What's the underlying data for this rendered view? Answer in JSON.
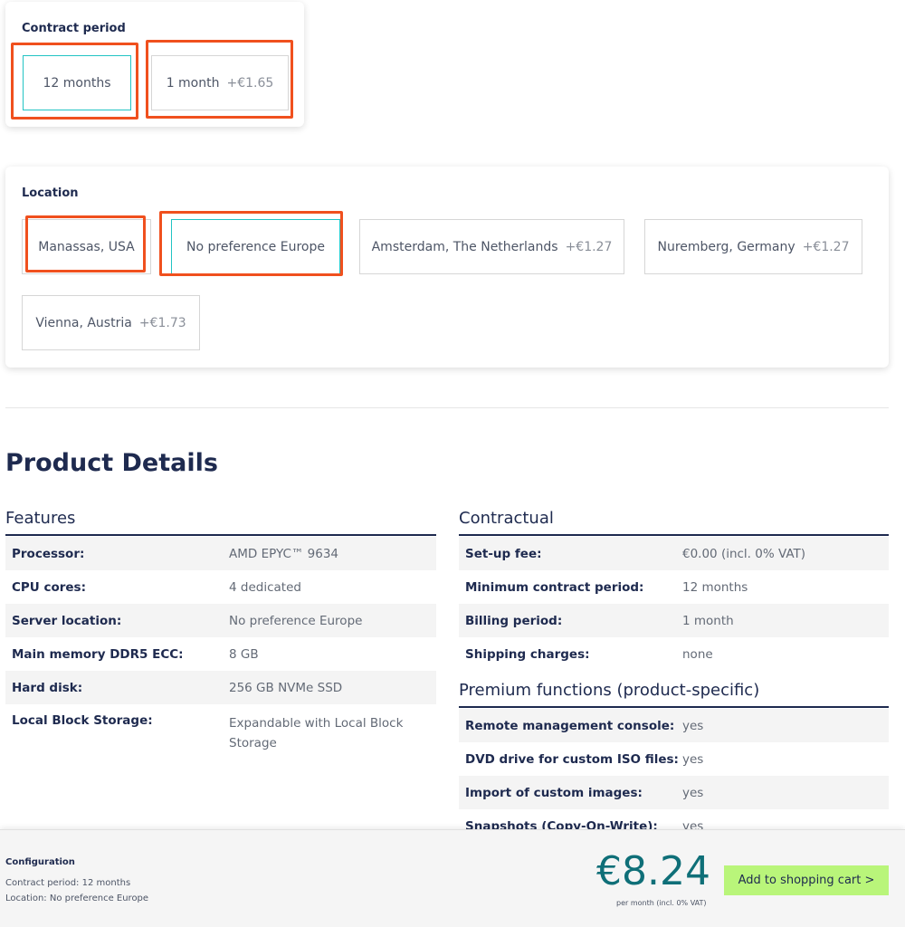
{
  "contract_period": {
    "title": "Contract period",
    "options": [
      {
        "label": "12 months",
        "price": ""
      },
      {
        "label": "1 month",
        "price": "+€1.65"
      }
    ]
  },
  "location": {
    "title": "Location",
    "options": [
      {
        "label": "Manassas, USA",
        "price": ""
      },
      {
        "label": "No preference Europe",
        "price": ""
      },
      {
        "label": "Amsterdam, The Netherlands",
        "price": "+€1.27"
      },
      {
        "label": "Nuremberg, Germany",
        "price": "+€1.27"
      },
      {
        "label": "Vienna, Austria",
        "price": "+€1.73"
      }
    ]
  },
  "product_details": {
    "title": "Product Details",
    "features": {
      "title": "Features",
      "rows": [
        {
          "label": "Processor:",
          "value": "AMD EPYC™ 9634"
        },
        {
          "label": "CPU cores:",
          "value": "4 dedicated"
        },
        {
          "label": "Server location:",
          "value": "No preference Europe"
        },
        {
          "label": "Main memory DDR5 ECC:",
          "value": "8 GB"
        },
        {
          "label": "Hard disk:",
          "value": "256 GB NVMe SSD"
        },
        {
          "label": "Local Block Storage:",
          "value": "Expandable with Local Block Storage"
        }
      ]
    },
    "contractual": {
      "title": "Contractual",
      "rows": [
        {
          "label": "Set-up fee:",
          "value": "€0.00 (incl. 0% VAT)"
        },
        {
          "label": "Minimum contract period:",
          "value": "12 months"
        },
        {
          "label": "Billing period:",
          "value": "1 month"
        },
        {
          "label": "Shipping charges:",
          "value": "none"
        }
      ]
    },
    "premium": {
      "title": "Premium functions (product-specific)",
      "rows": [
        {
          "label": "Remote management console:",
          "value": "yes"
        },
        {
          "label": "DVD drive for custom ISO files:",
          "value": "yes"
        },
        {
          "label": "Import of custom images:",
          "value": "yes"
        },
        {
          "label": "Snapshots (Copy-On-Write):",
          "value": "yes"
        }
      ]
    }
  },
  "footer": {
    "config_title": "Configuration",
    "config_contract": "Contract period: 12 months",
    "config_location": "Location: No preference Europe",
    "price": "€8.24",
    "price_note": "per month (incl. 0% VAT)",
    "cart_label": "Add to shopping cart >"
  },
  "colors": {
    "accent_selected": "#22c4c4",
    "highlight": "#f0501e",
    "cart_button": "#b9f57a",
    "navy": "#1e2a4f"
  }
}
